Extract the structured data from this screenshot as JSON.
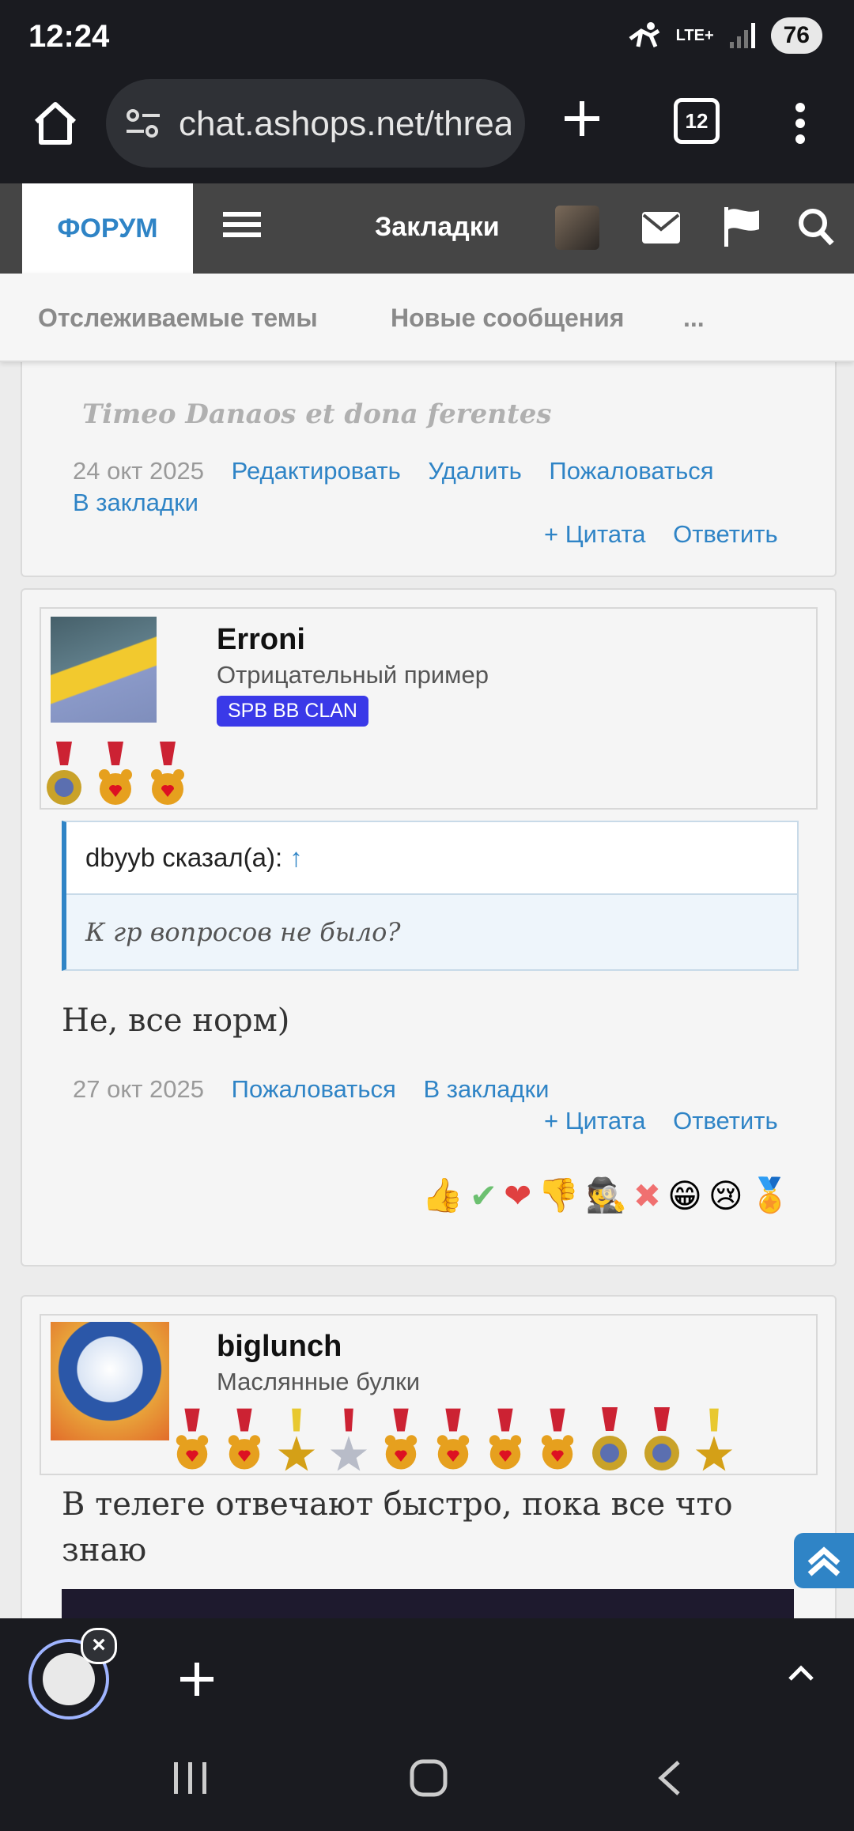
{
  "status_bar": {
    "time": "12:24",
    "network": "LTE+",
    "battery": "76"
  },
  "browser": {
    "url": "chat.ashops.net/threads/...",
    "tab_count": "12"
  },
  "forum_nav": {
    "forum": "ФОРУМ",
    "bookmarks": "Закладки"
  },
  "sub_nav": {
    "watched": "Отслеживаемые темы",
    "new_posts": "Новые сообщения",
    "more": "..."
  },
  "post1": {
    "signature": "Timeo Danaos et dona ferentes",
    "date": "24 окт 2025",
    "edit": "Редактировать",
    "delete": "Удалить",
    "report": "Пожаловаться",
    "bookmark": "В закладки",
    "quote": "+ Цитата",
    "reply": "Ответить"
  },
  "post2": {
    "username": "Erroni",
    "user_title": "Отрицательный пример",
    "banner": "SPB BB CLAN",
    "quote_author": "dbyyb сказал(а):",
    "quote_arrow": "↑",
    "quote_text": "К гр вопросов не было?",
    "message": "Не, все норм)",
    "date": "27 окт 2025",
    "report": "Пожаловаться",
    "bookmark": "В закладки",
    "quote": "+ Цитата",
    "reply": "Ответить",
    "reactions": [
      "thumbs-up",
      "check",
      "heart",
      "thumbs-down",
      "spy",
      "cross",
      "grin",
      "sad",
      "medal"
    ]
  },
  "post3": {
    "username": "biglunch",
    "user_title": "Маслянные булки",
    "message_line1": "В телеге отвечают быстро, пока все что",
    "message_line2": "знаю"
  },
  "colors": {
    "link": "#2f84c6",
    "nav_bg": "#454545",
    "banner": "#3a39e8"
  }
}
